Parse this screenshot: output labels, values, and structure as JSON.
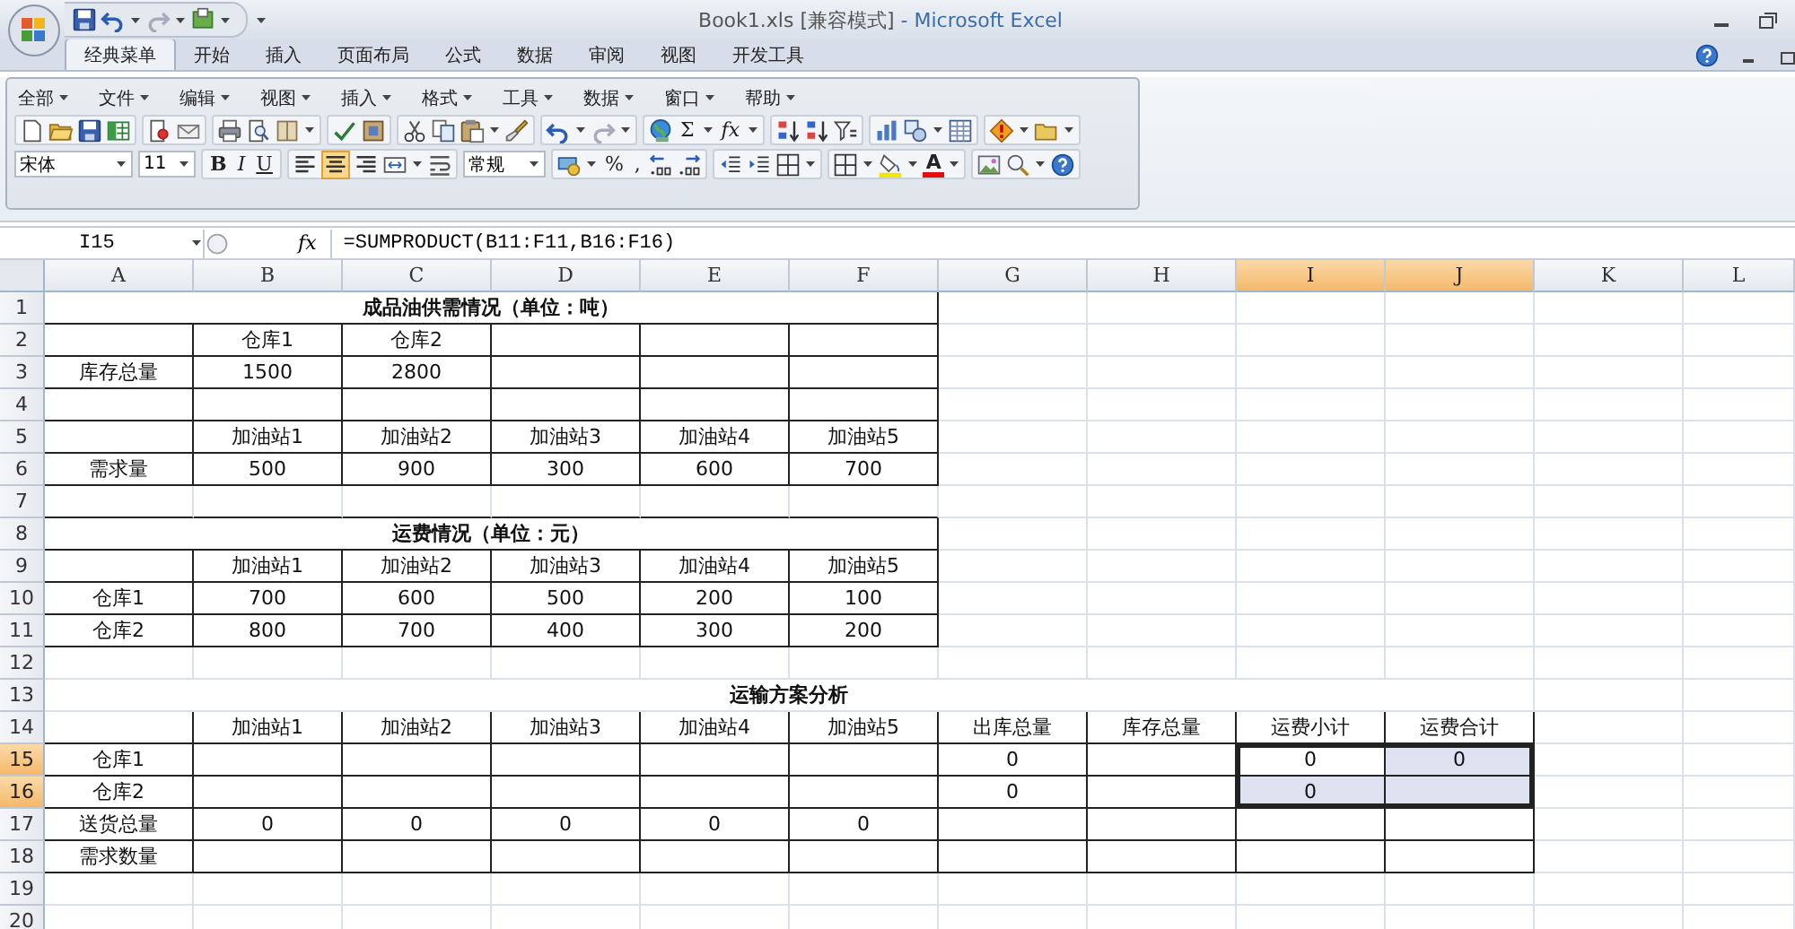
{
  "title_bar": {
    "document": "Book1.xls  [兼容模式]",
    "app": "- Microsoft Excel"
  },
  "ribbon_tabs": [
    {
      "label": "经典菜单",
      "selected": true
    },
    {
      "label": "开始",
      "selected": false
    },
    {
      "label": "插入",
      "selected": false
    },
    {
      "label": "页面布局",
      "selected": false
    },
    {
      "label": "公式",
      "selected": false
    },
    {
      "label": "数据",
      "selected": false
    },
    {
      "label": "审阅",
      "selected": false
    },
    {
      "label": "视图",
      "selected": false
    },
    {
      "label": "开发工具",
      "selected": false
    }
  ],
  "classic_menu": {
    "menus": [
      "全部",
      "文件",
      "编辑",
      "视图",
      "插入",
      "格式",
      "工具",
      "数据",
      "窗口",
      "帮助"
    ],
    "sum": "Σ",
    "function": "fx",
    "font": "宋体",
    "font_size": "11",
    "bold": "B",
    "italic": "I",
    "underline": "U",
    "number_format": "常规",
    "percent": "%",
    "comma": ",",
    "font_color": "A"
  },
  "formula_bar": {
    "name_box": "I15",
    "fx": "fx",
    "formula": "=SUMPRODUCT(B11:F11,B16:F16)"
  },
  "sheet": {
    "columns": [
      {
        "label": "A",
        "selected": false
      },
      {
        "label": "B",
        "selected": false
      },
      {
        "label": "C",
        "selected": false
      },
      {
        "label": "D",
        "selected": false
      },
      {
        "label": "E",
        "selected": false
      },
      {
        "label": "F",
        "selected": false
      },
      {
        "label": "G",
        "selected": false
      },
      {
        "label": "H",
        "selected": false
      },
      {
        "label": "I",
        "selected": true
      },
      {
        "label": "J",
        "selected": true
      },
      {
        "label": "K",
        "selected": false
      },
      {
        "label": "L",
        "selected": false
      }
    ],
    "rows": [
      {
        "label": "1",
        "selected": false,
        "kind": "title",
        "title": "成品油供需情况（单位：吨）"
      },
      {
        "label": "2",
        "selected": false,
        "kind": "cells",
        "cells": {
          "B": "仓库1",
          "C": "仓库2"
        }
      },
      {
        "label": "3",
        "selected": false,
        "kind": "cells",
        "cells": {
          "A": "库存总量",
          "B": "1500",
          "C": "2800"
        }
      },
      {
        "label": "4",
        "selected": false,
        "kind": "cells"
      },
      {
        "label": "5",
        "selected": false,
        "kind": "cells",
        "cells": {
          "B": "加油站1",
          "C": "加油站2",
          "D": "加油站3",
          "E": "加油站4",
          "F": "加油站5"
        }
      },
      {
        "label": "6",
        "selected": false,
        "kind": "cells",
        "cells": {
          "A": "需求量",
          "B": "500",
          "C": "900",
          "D": "300",
          "E": "600",
          "F": "700"
        }
      },
      {
        "label": "7",
        "selected": false,
        "kind": "cells"
      },
      {
        "label": "8",
        "selected": false,
        "kind": "title",
        "title": "运费情况（单位：元）"
      },
      {
        "label": "9",
        "selected": false,
        "kind": "cells",
        "cells": {
          "B": "加油站1",
          "C": "加油站2",
          "D": "加油站3",
          "E": "加油站4",
          "F": "加油站5"
        }
      },
      {
        "label": "10",
        "selected": false,
        "kind": "cells",
        "cells": {
          "A": "仓库1",
          "B": "700",
          "C": "600",
          "D": "500",
          "E": "200",
          "F": "100"
        }
      },
      {
        "label": "11",
        "selected": false,
        "kind": "cells",
        "cells": {
          "A": "仓库2",
          "B": "800",
          "C": "700",
          "D": "400",
          "E": "300",
          "F": "200"
        }
      },
      {
        "label": "12",
        "selected": false,
        "kind": "cells"
      },
      {
        "label": "13",
        "selected": false,
        "kind": "merged",
        "cells": {
          "E": "运输方案分析"
        }
      },
      {
        "label": "14",
        "selected": false,
        "kind": "cells",
        "cells": {
          "B": "加油站1",
          "C": "加油站2",
          "D": "加油站3",
          "E": "加油站4",
          "F": "加油站5",
          "G": "出库总量",
          "H": "库存总量",
          "I": "运费小计",
          "J": "运费合计"
        }
      },
      {
        "label": "15",
        "selected": true,
        "kind": "cells",
        "cells": {
          "A": "仓库1",
          "G": "0",
          "I": "0",
          "J": "0"
        }
      },
      {
        "label": "16",
        "selected": true,
        "kind": "cells",
        "cells": {
          "A": "仓库2",
          "G": "0",
          "I": "0"
        }
      },
      {
        "label": "17",
        "selected": false,
        "kind": "cells",
        "cells": {
          "A": "送货总量",
          "B": "0",
          "C": "0",
          "D": "0",
          "E": "0",
          "F": "0"
        }
      },
      {
        "label": "18",
        "selected": false,
        "kind": "cells",
        "cells": {
          "A": "需求数量"
        }
      },
      {
        "label": "19",
        "selected": false,
        "kind": "cells"
      },
      {
        "label": "20",
        "selected": false,
        "kind": "cells"
      }
    ]
  }
}
